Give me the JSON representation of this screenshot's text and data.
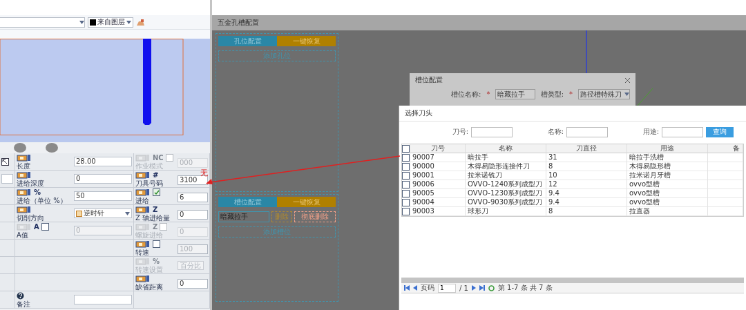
{
  "cad_panel": {
    "toolbar": {
      "color_select": {
        "value": "来自图层"
      }
    },
    "property_rows": [
      {
        "kind": "field",
        "label": "长度",
        "value": "28.00"
      },
      {
        "kind": "field",
        "label": "进给深度",
        "value": "0"
      },
      {
        "kind": "field",
        "label": "进给（单位 %）",
        "symbol": "%",
        "value": "50"
      },
      {
        "kind": "select",
        "label": "切削方向",
        "value": "逆时针"
      },
      {
        "kind": "check",
        "label": "A值",
        "symbol": "A",
        "checked": false,
        "disabled": true,
        "value": "0"
      },
      {
        "kind": "empty"
      },
      {
        "kind": "empty"
      },
      {
        "kind": "empty"
      },
      {
        "kind": "note",
        "label": "备注"
      }
    ],
    "side_rows": [
      {
        "kind": "check",
        "label": "作业模式",
        "symbol": "NC",
        "checked": false,
        "disabled": true,
        "value": "000"
      },
      {
        "kind": "field",
        "label": "刀具号码",
        "symbol": "#",
        "value": "3100"
      },
      {
        "kind": "check",
        "label": "进给",
        "checked": true,
        "disabled": false,
        "value": "6"
      },
      {
        "kind": "field",
        "label": "Z 轴进给量",
        "symbol": "Z",
        "value": "0"
      },
      {
        "kind": "check",
        "label": "螺旋进给",
        "symbol": "Z",
        "checked": false,
        "disabled": true,
        "value": "0"
      },
      {
        "kind": "check",
        "label": "转速",
        "checked": false,
        "disabled": false,
        "value": "100"
      },
      {
        "kind": "button",
        "label": "转速设置",
        "symbol": "%",
        "button": "百分比",
        "disabled": true
      },
      {
        "kind": "field",
        "label": "缺省距离",
        "value": "0"
      },
      {
        "kind": "empty"
      }
    ]
  },
  "annotation": {
    "text": "无"
  },
  "hardware_config": {
    "title": "五金孔槽配置",
    "hole_section": {
      "buttons": [
        "孔位配置",
        "一键恢复"
      ],
      "add_button": "添加孔位"
    },
    "slot_section": {
      "buttons": [
        "槽位配置",
        "一键恢复"
      ],
      "slots": [
        {
          "name": "暗藏拉手",
          "delete": "删除",
          "purge": "彻底删除"
        }
      ],
      "add_button": "添加槽位"
    }
  },
  "slot_dialog": {
    "title": "槽位配置",
    "fields": [
      {
        "kind": "input",
        "label": "槽位名称:",
        "required_mark": "*",
        "value": "暗藏拉手"
      },
      {
        "kind": "select",
        "label": "槽类型:",
        "required_mark": "*",
        "value": "路径槽特殊刀"
      }
    ]
  },
  "tool_dialog": {
    "title": "选择刀头",
    "filters": [
      {
        "label": "刀号:"
      },
      {
        "label": "名称:"
      },
      {
        "label": "用途:"
      }
    ],
    "search_button": "查询",
    "table": {
      "select_all_checked": false,
      "columns": [
        "刀号",
        "名称",
        "刀直径",
        "用途",
        "备"
      ],
      "rows": [
        {
          "checked": false,
          "cells": [
            "90007",
            "暗拉手",
            "31",
            "暗拉手洗槽"
          ]
        },
        {
          "checked": false,
          "cells": [
            "90000",
            "木得易隐形连接件刀",
            "8",
            "木得易隐形槽"
          ]
        },
        {
          "checked": false,
          "cells": [
            "90001",
            "拉米诺铣刀",
            "10",
            "拉米诺月牙槽"
          ]
        },
        {
          "checked": false,
          "cells": [
            "90006",
            "OVVO-1240系列成型刀",
            "12",
            "ovvo型槽"
          ]
        },
        {
          "checked": false,
          "cells": [
            "90005",
            "OVVO-1230系列成型刀",
            "9.4",
            "ovvo型槽"
          ]
        },
        {
          "checked": false,
          "cells": [
            "90004",
            "OVVO-9030系列成型刀",
            "9.4",
            "ovvo型槽"
          ]
        },
        {
          "checked": false,
          "cells": [
            "90003",
            "球形刀",
            "8",
            "拉直器"
          ]
        }
      ]
    },
    "pager": {
      "page_label": "页码",
      "page": "1",
      "total": "/ 1",
      "summary": "第 1-7 条 共 7 条"
    }
  }
}
